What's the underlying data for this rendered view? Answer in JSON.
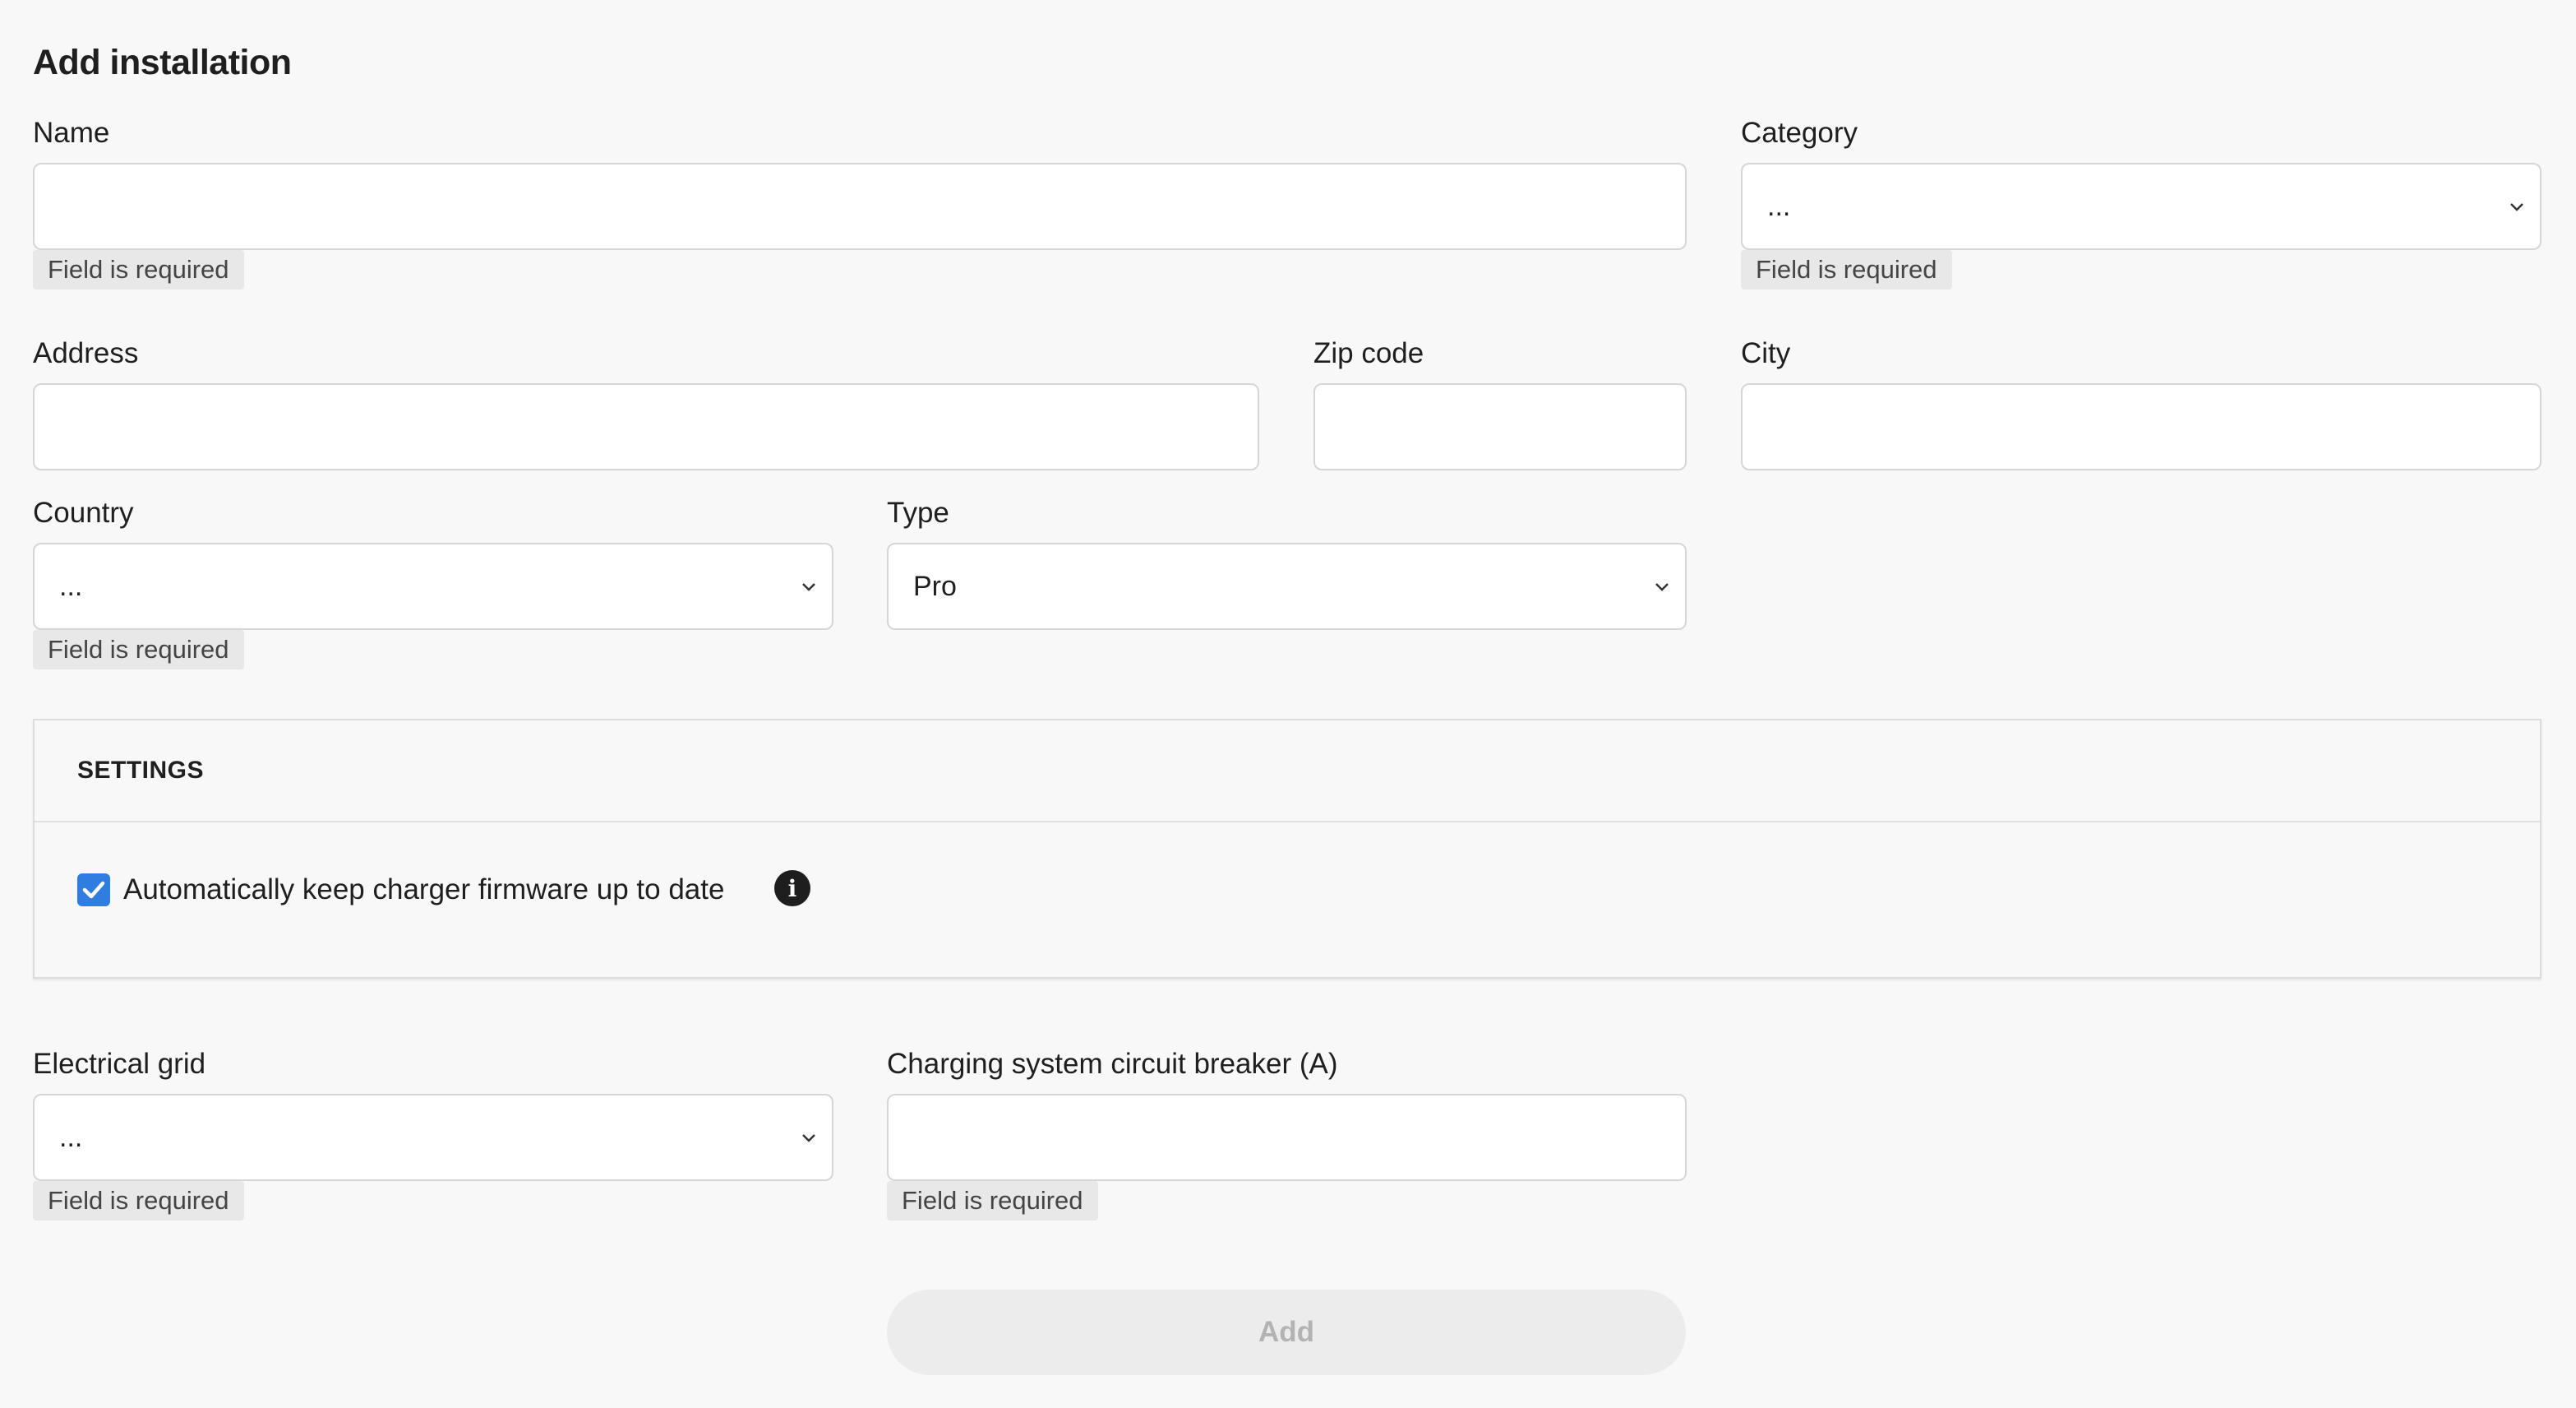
{
  "form": {
    "title": "Add installation",
    "name": {
      "label": "Name",
      "value": "",
      "placeholder": "",
      "error": "Field is required"
    },
    "category": {
      "label": "Category",
      "value": "...",
      "error": "Field is required"
    },
    "address": {
      "label": "Address",
      "value": "",
      "placeholder": ""
    },
    "zip_code": {
      "label": "Zip code",
      "value": "",
      "placeholder": ""
    },
    "city": {
      "label": "City",
      "value": "",
      "placeholder": ""
    },
    "country": {
      "label": "Country",
      "value": "...",
      "error": "Field is required"
    },
    "type": {
      "label": "Type",
      "value": "Pro"
    },
    "settings": {
      "header": "SETTINGS",
      "auto_firmware": {
        "label": "Automatically keep charger firmware up to date",
        "checked": true
      }
    },
    "electrical_grid": {
      "label": "Electrical grid",
      "value": "...",
      "error": "Field is required"
    },
    "circuit_breaker": {
      "label": "Charging system circuit breaker (A)",
      "value": "",
      "placeholder": "",
      "error": "Field is required"
    },
    "add_button_label": "Add"
  },
  "colors": {
    "accent": "#2f7de1",
    "disabled_button_bg": "#ececec",
    "disabled_button_text": "#b3b3b3",
    "error_badge_bg": "#e8e8e8"
  }
}
